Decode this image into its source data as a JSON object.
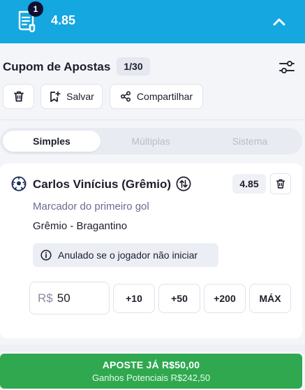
{
  "header": {
    "selection_count": "1",
    "total_odds": "4.85"
  },
  "slip": {
    "title": "Cupom de Apostas",
    "counter": "1/30",
    "save_label": "Salvar",
    "share_label": "Compartilhar"
  },
  "tabs": [
    {
      "label": "Simples",
      "active": true
    },
    {
      "label": "Múltiplas",
      "active": false
    },
    {
      "label": "Sistema",
      "active": false
    }
  ],
  "selection": {
    "player": "Carlos Vinícius (Grêmio)",
    "odds": "4.85",
    "market": "Marcador do primeiro gol",
    "event": "Grêmio - Bragantino",
    "notice": "Anulado se o jogador não iniciar"
  },
  "stake": {
    "currency": "R$",
    "value": "50",
    "quick_amounts": [
      "+10",
      "+50",
      "+200",
      "MÁX"
    ]
  },
  "bet_button": {
    "label": "APOSTE JÁ  R$50,00",
    "potential": "Ganhos Potenciais R$242,50"
  },
  "colors": {
    "header_bg": "#14a7e0",
    "bet_button_bg": "#2fa84f",
    "badge_bg": "#0d1030"
  },
  "icons": [
    "bet-slip-icon",
    "chevron-up-icon",
    "sliders-icon",
    "trash-icon",
    "bookmark-add-icon",
    "share-icon",
    "soccer-ball-icon",
    "swap-icon",
    "info-icon"
  ]
}
